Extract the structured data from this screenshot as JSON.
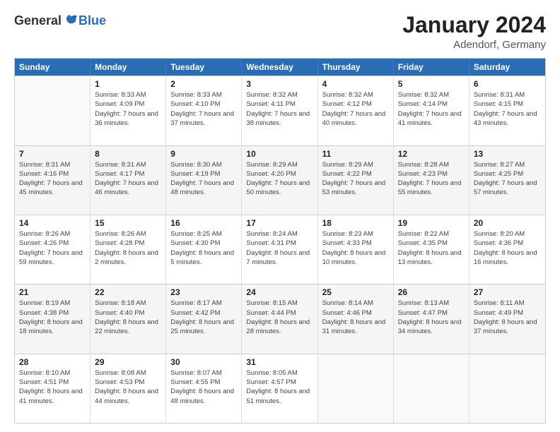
{
  "logo": {
    "general": "General",
    "blue": "Blue"
  },
  "title": "January 2024",
  "location": "Adendorf, Germany",
  "header_days": [
    "Sunday",
    "Monday",
    "Tuesday",
    "Wednesday",
    "Thursday",
    "Friday",
    "Saturday"
  ],
  "weeks": [
    [
      {
        "day": "",
        "sunrise": "",
        "sunset": "",
        "daylight": ""
      },
      {
        "day": "1",
        "sunrise": "Sunrise: 8:33 AM",
        "sunset": "Sunset: 4:09 PM",
        "daylight": "Daylight: 7 hours and 36 minutes."
      },
      {
        "day": "2",
        "sunrise": "Sunrise: 8:33 AM",
        "sunset": "Sunset: 4:10 PM",
        "daylight": "Daylight: 7 hours and 37 minutes."
      },
      {
        "day": "3",
        "sunrise": "Sunrise: 8:32 AM",
        "sunset": "Sunset: 4:11 PM",
        "daylight": "Daylight: 7 hours and 38 minutes."
      },
      {
        "day": "4",
        "sunrise": "Sunrise: 8:32 AM",
        "sunset": "Sunset: 4:12 PM",
        "daylight": "Daylight: 7 hours and 40 minutes."
      },
      {
        "day": "5",
        "sunrise": "Sunrise: 8:32 AM",
        "sunset": "Sunset: 4:14 PM",
        "daylight": "Daylight: 7 hours and 41 minutes."
      },
      {
        "day": "6",
        "sunrise": "Sunrise: 8:31 AM",
        "sunset": "Sunset: 4:15 PM",
        "daylight": "Daylight: 7 hours and 43 minutes."
      }
    ],
    [
      {
        "day": "7",
        "sunrise": "Sunrise: 8:31 AM",
        "sunset": "Sunset: 4:16 PM",
        "daylight": "Daylight: 7 hours and 45 minutes."
      },
      {
        "day": "8",
        "sunrise": "Sunrise: 8:31 AM",
        "sunset": "Sunset: 4:17 PM",
        "daylight": "Daylight: 7 hours and 46 minutes."
      },
      {
        "day": "9",
        "sunrise": "Sunrise: 8:30 AM",
        "sunset": "Sunset: 4:19 PM",
        "daylight": "Daylight: 7 hours and 48 minutes."
      },
      {
        "day": "10",
        "sunrise": "Sunrise: 8:29 AM",
        "sunset": "Sunset: 4:20 PM",
        "daylight": "Daylight: 7 hours and 50 minutes."
      },
      {
        "day": "11",
        "sunrise": "Sunrise: 8:29 AM",
        "sunset": "Sunset: 4:22 PM",
        "daylight": "Daylight: 7 hours and 53 minutes."
      },
      {
        "day": "12",
        "sunrise": "Sunrise: 8:28 AM",
        "sunset": "Sunset: 4:23 PM",
        "daylight": "Daylight: 7 hours and 55 minutes."
      },
      {
        "day": "13",
        "sunrise": "Sunrise: 8:27 AM",
        "sunset": "Sunset: 4:25 PM",
        "daylight": "Daylight: 7 hours and 57 minutes."
      }
    ],
    [
      {
        "day": "14",
        "sunrise": "Sunrise: 8:26 AM",
        "sunset": "Sunset: 4:26 PM",
        "daylight": "Daylight: 7 hours and 59 minutes."
      },
      {
        "day": "15",
        "sunrise": "Sunrise: 8:26 AM",
        "sunset": "Sunset: 4:28 PM",
        "daylight": "Daylight: 8 hours and 2 minutes."
      },
      {
        "day": "16",
        "sunrise": "Sunrise: 8:25 AM",
        "sunset": "Sunset: 4:30 PM",
        "daylight": "Daylight: 8 hours and 5 minutes."
      },
      {
        "day": "17",
        "sunrise": "Sunrise: 8:24 AM",
        "sunset": "Sunset: 4:31 PM",
        "daylight": "Daylight: 8 hours and 7 minutes."
      },
      {
        "day": "18",
        "sunrise": "Sunrise: 8:23 AM",
        "sunset": "Sunset: 4:33 PM",
        "daylight": "Daylight: 8 hours and 10 minutes."
      },
      {
        "day": "19",
        "sunrise": "Sunrise: 8:22 AM",
        "sunset": "Sunset: 4:35 PM",
        "daylight": "Daylight: 8 hours and 13 minutes."
      },
      {
        "day": "20",
        "sunrise": "Sunrise: 8:20 AM",
        "sunset": "Sunset: 4:36 PM",
        "daylight": "Daylight: 8 hours and 16 minutes."
      }
    ],
    [
      {
        "day": "21",
        "sunrise": "Sunrise: 8:19 AM",
        "sunset": "Sunset: 4:38 PM",
        "daylight": "Daylight: 8 hours and 18 minutes."
      },
      {
        "day": "22",
        "sunrise": "Sunrise: 8:18 AM",
        "sunset": "Sunset: 4:40 PM",
        "daylight": "Daylight: 8 hours and 22 minutes."
      },
      {
        "day": "23",
        "sunrise": "Sunrise: 8:17 AM",
        "sunset": "Sunset: 4:42 PM",
        "daylight": "Daylight: 8 hours and 25 minutes."
      },
      {
        "day": "24",
        "sunrise": "Sunrise: 8:15 AM",
        "sunset": "Sunset: 4:44 PM",
        "daylight": "Daylight: 8 hours and 28 minutes."
      },
      {
        "day": "25",
        "sunrise": "Sunrise: 8:14 AM",
        "sunset": "Sunset: 4:46 PM",
        "daylight": "Daylight: 8 hours and 31 minutes."
      },
      {
        "day": "26",
        "sunrise": "Sunrise: 8:13 AM",
        "sunset": "Sunset: 4:47 PM",
        "daylight": "Daylight: 8 hours and 34 minutes."
      },
      {
        "day": "27",
        "sunrise": "Sunrise: 8:11 AM",
        "sunset": "Sunset: 4:49 PM",
        "daylight": "Daylight: 8 hours and 37 minutes."
      }
    ],
    [
      {
        "day": "28",
        "sunrise": "Sunrise: 8:10 AM",
        "sunset": "Sunset: 4:51 PM",
        "daylight": "Daylight: 8 hours and 41 minutes."
      },
      {
        "day": "29",
        "sunrise": "Sunrise: 8:08 AM",
        "sunset": "Sunset: 4:53 PM",
        "daylight": "Daylight: 8 hours and 44 minutes."
      },
      {
        "day": "30",
        "sunrise": "Sunrise: 8:07 AM",
        "sunset": "Sunset: 4:55 PM",
        "daylight": "Daylight: 8 hours and 48 minutes."
      },
      {
        "day": "31",
        "sunrise": "Sunrise: 8:05 AM",
        "sunset": "Sunset: 4:57 PM",
        "daylight": "Daylight: 8 hours and 51 minutes."
      },
      {
        "day": "",
        "sunrise": "",
        "sunset": "",
        "daylight": ""
      },
      {
        "day": "",
        "sunrise": "",
        "sunset": "",
        "daylight": ""
      },
      {
        "day": "",
        "sunrise": "",
        "sunset": "",
        "daylight": ""
      }
    ]
  ]
}
